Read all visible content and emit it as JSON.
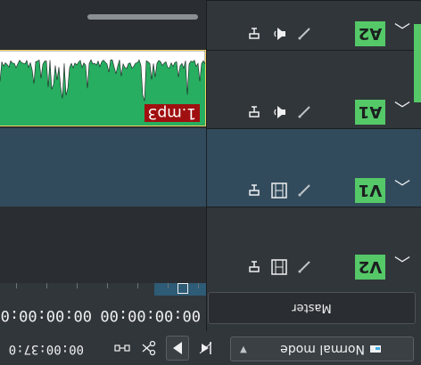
{
  "status_bar": {
    "edit_mode": "Normal mode",
    "timecode": "00:00:37:0"
  },
  "ruler": {
    "timecode_1": "00:00:00:00",
    "timecode_2": "00:00:00:0"
  },
  "master_label": "Master",
  "tracks": [
    {
      "name": "V2",
      "kind": "video"
    },
    {
      "name": "V1",
      "kind": "video"
    },
    {
      "name": "A1",
      "kind": "audio"
    },
    {
      "name": "A2",
      "kind": "audio"
    }
  ],
  "clip": {
    "label": "1.mp3"
  },
  "colors": {
    "track_tag": "#55c868",
    "audio_clip": "#27ae60",
    "clip_label_bg": "#a01010",
    "selected_track": "#324b5c"
  }
}
